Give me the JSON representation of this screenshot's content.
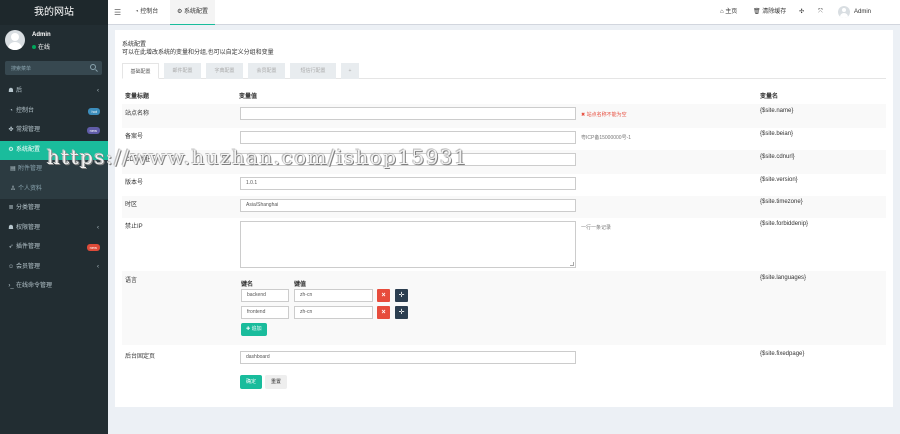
{
  "site": {
    "title": "我的网站"
  },
  "user": {
    "name": "Admin",
    "status": "在线"
  },
  "search": {
    "placeholder": "搜索菜单"
  },
  "sidebar": {
    "items": [
      {
        "label": "后",
        "icon": "users-icon",
        "arrow": "‹"
      },
      {
        "label": "控制台",
        "icon": "dashboard-icon",
        "badge": "hot",
        "badge_color": "#3c8dbc"
      },
      {
        "label": "常规管理",
        "icon": "cogs-icon",
        "badge": "new",
        "badge_color": "#605ca8"
      },
      {
        "label": "系统配置",
        "icon": "gear-icon",
        "active": true
      },
      {
        "label": "附件管理",
        "icon": "attachment-icon",
        "sub": true
      },
      {
        "label": "个人资料",
        "icon": "user-icon",
        "sub": true
      },
      {
        "label": "分类管理",
        "icon": "list-icon"
      },
      {
        "label": "权限管理",
        "icon": "group-icon",
        "arrow": "‹"
      },
      {
        "label": "插件管理",
        "icon": "rocket-icon",
        "badge": "new",
        "badge_color": "#dd4b39"
      },
      {
        "label": "会员管理",
        "icon": "member-icon",
        "arrow": "‹"
      },
      {
        "label": "在线命令管理",
        "icon": "terminal-icon"
      }
    ]
  },
  "topbar": {
    "tabs": [
      {
        "label": "控制台",
        "icon": "dashboard-icon"
      },
      {
        "label": "系统配置",
        "icon": "gear-icon"
      }
    ],
    "home": "主页",
    "clear_cache": "清除缓存",
    "username": "Admin"
  },
  "panel": {
    "title": "系统配置",
    "description": "可以在此增改系统的变量和分组,也可以自定义分组和变量",
    "tabs": [
      "基础配置",
      "邮件配置",
      "字典配置",
      "会员配置",
      "短信行配置",
      "+"
    ],
    "headers": {
      "title": "变量标题",
      "value": "变量值",
      "name": "变量名"
    },
    "rows": [
      {
        "title": "站点名称",
        "value": "",
        "error": "站点名称不能为空",
        "name": "{$site.name}"
      },
      {
        "title": "备案号",
        "value": "",
        "hint": "粤ICP备15000000号-1",
        "name": "{$site.beian}"
      },
      {
        "title": "CDN地址",
        "value": "",
        "name": "{$site.cdnurl}"
      },
      {
        "title": "版本号",
        "value": "1.0.1",
        "name": "{$site.version}"
      },
      {
        "title": "时区",
        "value": "Asia/Shanghai",
        "name": "{$site.timezone}"
      },
      {
        "title": "禁止IP",
        "value": "",
        "hint": "一行一条记录",
        "name": "{$site.forbiddenip}"
      },
      {
        "title": "语言",
        "name": "{$site.languages}"
      },
      {
        "title": "后台固定页",
        "value": "dashboard",
        "name": "{$site.fixedpage}"
      }
    ],
    "languages": {
      "key_header": "键名",
      "value_header": "键值",
      "pairs": [
        {
          "key": "backend",
          "value": "zh-cn"
        },
        {
          "key": "frontend",
          "value": "zh-cn"
        }
      ],
      "add_label": "追加"
    },
    "buttons": {
      "ok": "确定",
      "reset": "重置"
    }
  },
  "watermark": "https://www.huzhan.com/ishop15931"
}
